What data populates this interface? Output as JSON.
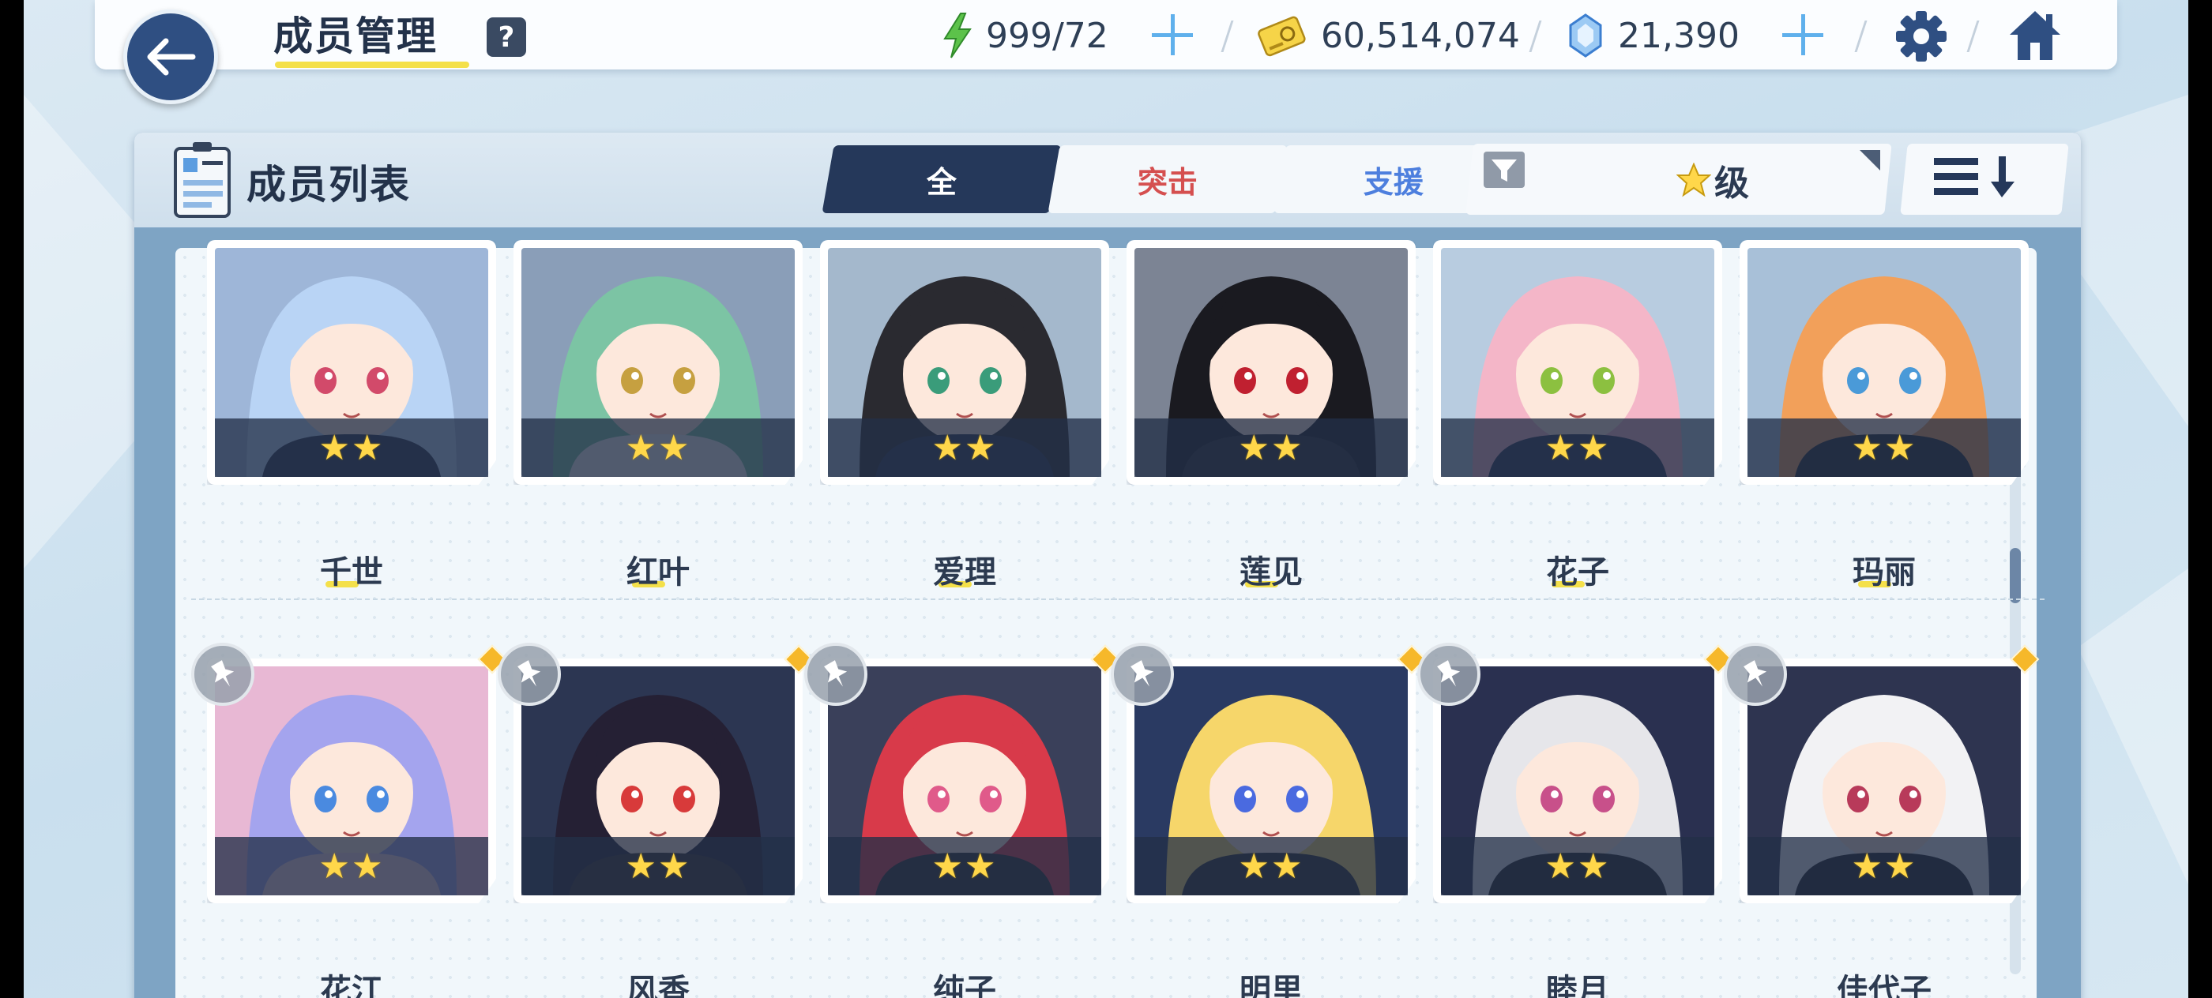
{
  "header": {
    "title": "成员管理",
    "help_label": "?",
    "ap": "999/72",
    "credits": "60,514,074",
    "pyroxene": "21,390"
  },
  "panel": {
    "title": "成员列表",
    "tabs": [
      {
        "label": "全",
        "active": true
      },
      {
        "label": "突击",
        "color": "#d54f4f"
      },
      {
        "label": "支援",
        "color": "#4d7fde"
      }
    ],
    "filter_label": "级",
    "sort_icon": "sort-descending-icon"
  },
  "colors": {
    "header_accent": "#f4e04a",
    "back_button": "#2f4f82",
    "tab_active": "#25385a",
    "star": "#ffd74a"
  },
  "members": [
    {
      "name": "千世",
      "stars": "★★",
      "hair": "#b9d4f5",
      "bg": "#9eb6d8",
      "eye": "#d24a6a",
      "outfit": "#2a3550",
      "pinned": false
    },
    {
      "name": "红叶",
      "stars": "★★",
      "hair": "#7cc4a4",
      "bg": "#8a9eb8",
      "eye": "#c6a040",
      "outfit": "#f4f4f4",
      "pinned": false
    },
    {
      "name": "爱理",
      "stars": "★★",
      "hair": "#2a2a30",
      "bg": "#a4b8cc",
      "eye": "#3a9c7a",
      "outfit": "#2c3450",
      "pinned": false
    },
    {
      "name": "莲见",
      "stars": "★★",
      "hair": "#1a1a20",
      "bg": "#7c8494",
      "eye": "#c02030",
      "outfit": "#2a2a32",
      "pinned": false
    },
    {
      "name": "花子",
      "stars": "★★",
      "hair": "#f4b6c8",
      "bg": "#b8cce0",
      "eye": "#8cc040",
      "outfit": "#2c3452",
      "pinned": false
    },
    {
      "name": "玛丽",
      "stars": "★★",
      "hair": "#f2a05a",
      "bg": "#a8c0d8",
      "eye": "#4a9ad8",
      "outfit": "#222630",
      "pinned": false
    },
    {
      "name": "花江",
      "stars": "★★",
      "hair": "#a4a4ee",
      "bg": "#e8b8d4",
      "eye": "#4a8ae0",
      "outfit": "#f7d6e4",
      "pinned": true
    },
    {
      "name": "风香",
      "stars": "★★",
      "hair": "#252034",
      "bg": "#2c3652",
      "eye": "#d83a3a",
      "outfit": "#3a3030",
      "pinned": true
    },
    {
      "name": "纯子",
      "stars": "★★",
      "hair": "#d83a4a",
      "bg": "#3a405a",
      "eye": "#e05a8a",
      "outfit": "#2a2a30",
      "pinned": true
    },
    {
      "name": "明里",
      "stars": "★★",
      "hair": "#f6d66a",
      "bg": "#2a3a62",
      "eye": "#4a6ae0",
      "outfit": "#2a2a30",
      "pinned": true
    },
    {
      "name": "睦月",
      "stars": "★★",
      "hair": "#e6e6ea",
      "bg": "#2a3050",
      "eye": "#c8508a",
      "outfit": "#222228",
      "pinned": true
    },
    {
      "name": "佳代子",
      "stars": "★★",
      "hair": "#f2f2f4",
      "bg": "#2e3450",
      "eye": "#b83a5a",
      "outfit": "#1e1e24",
      "pinned": true
    }
  ]
}
